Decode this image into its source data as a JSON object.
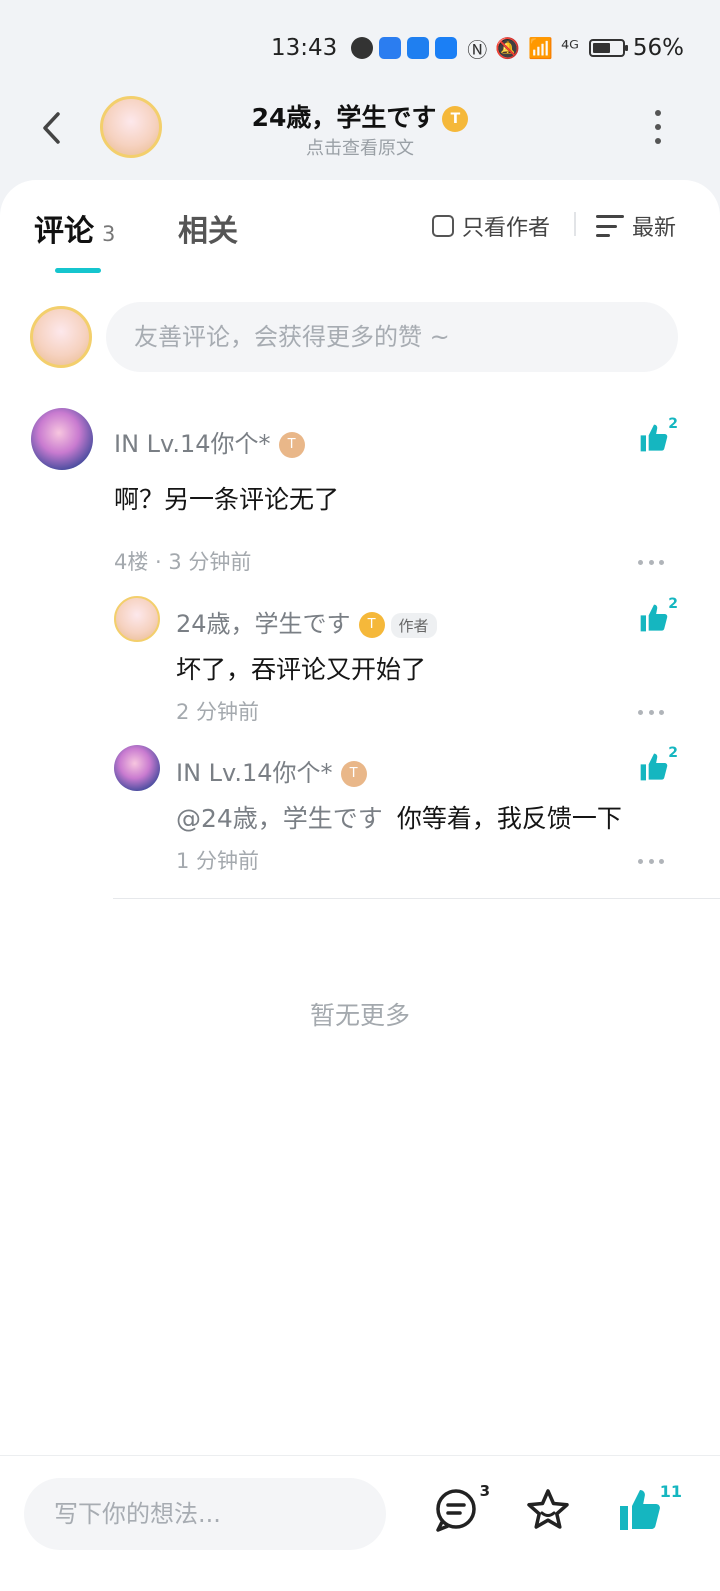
{
  "status_bar": {
    "time": "13:43",
    "network": "⁴ᴳ",
    "battery": "56%"
  },
  "header": {
    "title": "24歳，学生です",
    "title_badge": "T",
    "subtitle": "点击查看原文"
  },
  "tabs": {
    "comments_label": "评论",
    "comments_count": "3",
    "related_label": "相关"
  },
  "filters": {
    "author_only": "只看作者",
    "sort": "最新"
  },
  "composer": {
    "placeholder": "友善评论，会获得更多的赞 ~"
  },
  "comments": [
    {
      "user": "IN Lv.14你个*",
      "badge": "T",
      "text": "啊？另一条评论无了",
      "meta": "4楼 · 3 分钟前",
      "likes": "2"
    }
  ],
  "replies": [
    {
      "user": "24歳，学生です",
      "badge": "T",
      "author_tag": "作者",
      "text": "坏了，吞评论又开始了",
      "meta": "2 分钟前",
      "likes": "2"
    },
    {
      "user": "IN Lv.14你个*",
      "badge": "T",
      "mention": "@24歳，学生です",
      "text": "你等着，我反馈一下",
      "meta": "1 分钟前",
      "likes": "2"
    }
  ],
  "no_more_text": "暂无更多",
  "bottom_bar": {
    "placeholder": "写下你的想法...",
    "comment_count": "3",
    "like_count": "11"
  },
  "colors": {
    "accent": "#15c5ce",
    "background": "#f1f3f6",
    "muted_text": "#a4a9ae"
  }
}
